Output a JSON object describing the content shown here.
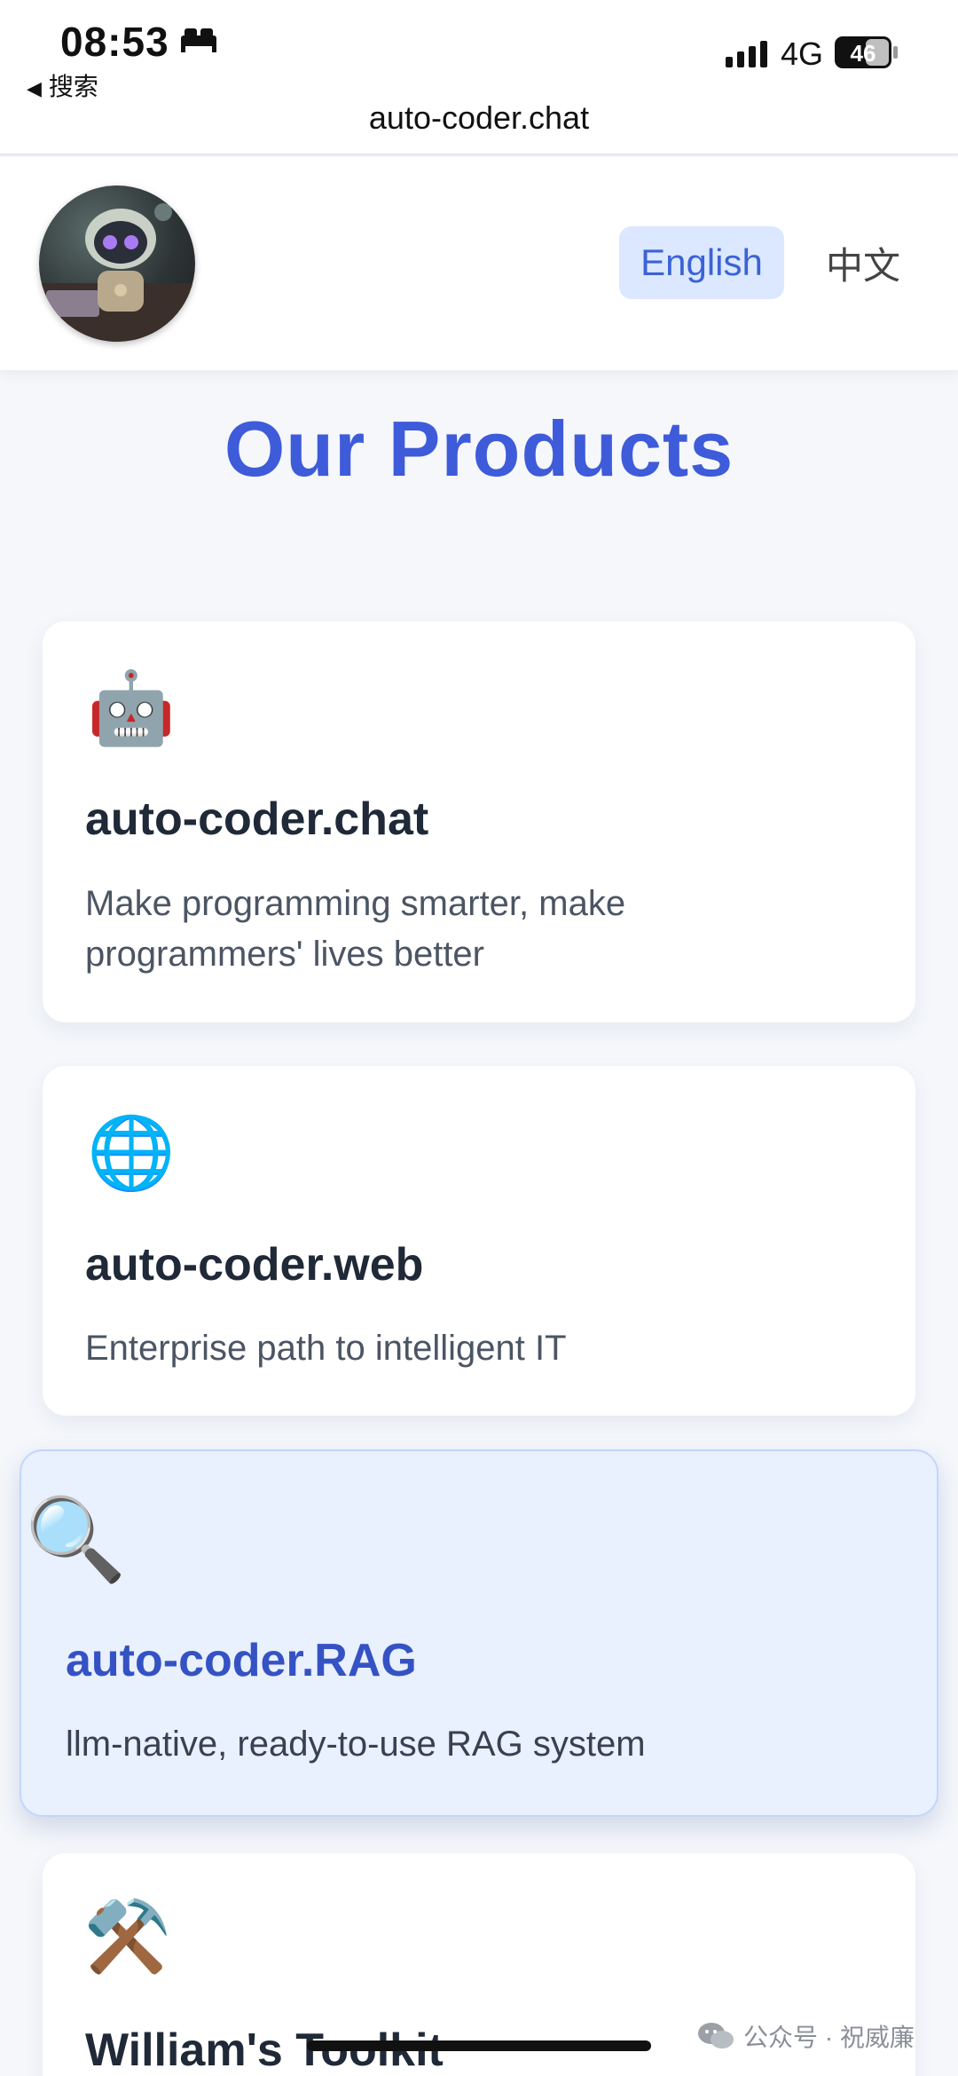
{
  "status_bar": {
    "time": "08:53",
    "back_label": "搜索",
    "network": "4G",
    "battery": "46"
  },
  "browser": {
    "url": "auto-coder.chat"
  },
  "header": {
    "lang_english": "English",
    "lang_chinese": "中文"
  },
  "main": {
    "title": "Our Products",
    "products": [
      {
        "icon": "🤖",
        "icon_name": "robot-icon",
        "title": "auto-coder.chat",
        "description": "Make programming smarter, make programmers' lives better"
      },
      {
        "icon": "🌐",
        "icon_name": "globe-icon",
        "title": "auto-coder.web",
        "description": "Enterprise path to intelligent IT"
      },
      {
        "icon": "🔍",
        "icon_name": "magnifier-icon",
        "title": "auto-coder.RAG",
        "description": "llm-native, ready-to-use RAG system"
      },
      {
        "icon": "⚒️",
        "icon_name": "hammer-wrench-icon",
        "title": "William's Toolkit",
        "description": ""
      }
    ]
  },
  "watermark": {
    "text": "公众号 · 祝威廉"
  },
  "colors": {
    "accent": "#3e5bd9",
    "lang_active_bg": "#dbe8ff",
    "highlight_card_bg": "#e9f0fe"
  }
}
